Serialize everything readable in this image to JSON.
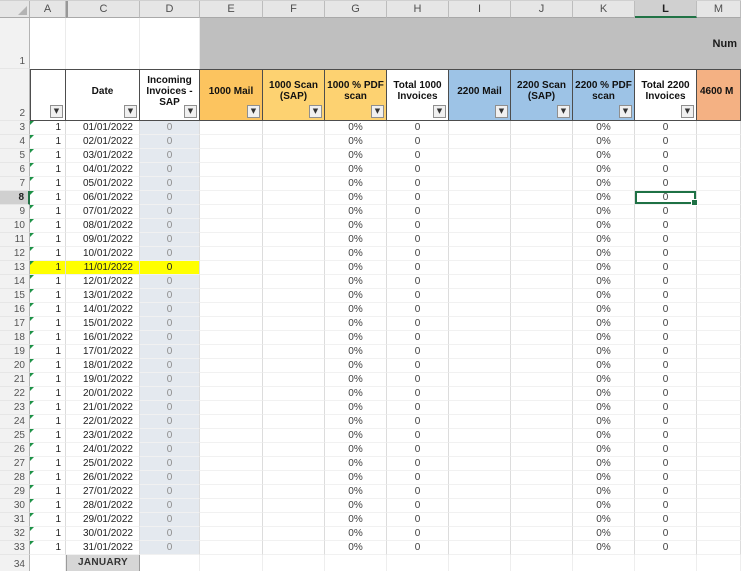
{
  "sheet": {
    "column_letters": [
      "A",
      "C",
      "D",
      "E",
      "F",
      "G",
      "H",
      "I",
      "J",
      "K",
      "L",
      "M"
    ],
    "hidden_column_after_A": true,
    "row1_n": "1",
    "header_row_n": "2",
    "row1_merged_label": "Num",
    "selection": {
      "cell": "L8",
      "column": "L",
      "row_n": 8
    },
    "highlight_color": "#ffff00",
    "selection_color": "#1e7145",
    "headers": [
      {
        "col": "A",
        "label": "",
        "bg": "#ffffff",
        "filter": true
      },
      {
        "col": "C",
        "label": "Date",
        "bg": "#ffffff",
        "filter": true
      },
      {
        "col": "D",
        "label": "Incoming Invoices - SAP",
        "bg": "#ffffff",
        "filter": true
      },
      {
        "col": "E",
        "label": "1000 Mail",
        "bg": "#fcc45f",
        "filter": true
      },
      {
        "col": "F",
        "label": "1000 Scan (SAP)",
        "bg": "#fdd271",
        "filter": true
      },
      {
        "col": "G",
        "label": "1000 % PDF scan",
        "bg": "#fdd271",
        "filter": true
      },
      {
        "col": "H",
        "label": "Total 1000 Invoices",
        "bg": "#ffffff",
        "filter": true
      },
      {
        "col": "I",
        "label": "2200 Mail",
        "bg": "#9dc3e6",
        "filter": true
      },
      {
        "col": "J",
        "label": "2200 Scan (SAP)",
        "bg": "#9dc3e6",
        "filter": true
      },
      {
        "col": "K",
        "label": "2200 % PDF scan",
        "bg": "#9dc3e6",
        "filter": true
      },
      {
        "col": "L",
        "label": "Total 2200 Invoices",
        "bg": "#ffffff",
        "filter": true
      },
      {
        "col": "M",
        "label": "4600 M",
        "bg": "#f4b183",
        "filter": false
      }
    ],
    "rows": [
      {
        "n": 3,
        "A": "1",
        "C": "01/01/2022",
        "D": "0",
        "G": "0%",
        "H": "0",
        "K": "0%",
        "L": "0"
      },
      {
        "n": 4,
        "A": "1",
        "C": "02/01/2022",
        "D": "0",
        "G": "0%",
        "H": "0",
        "K": "0%",
        "L": "0"
      },
      {
        "n": 5,
        "A": "1",
        "C": "03/01/2022",
        "D": "0",
        "G": "0%",
        "H": "0",
        "K": "0%",
        "L": "0"
      },
      {
        "n": 6,
        "A": "1",
        "C": "04/01/2022",
        "D": "0",
        "G": "0%",
        "H": "0",
        "K": "0%",
        "L": "0"
      },
      {
        "n": 7,
        "A": "1",
        "C": "05/01/2022",
        "D": "0",
        "G": "0%",
        "H": "0",
        "K": "0%",
        "L": "0"
      },
      {
        "n": 8,
        "A": "1",
        "C": "06/01/2022",
        "D": "0",
        "G": "0%",
        "H": "0",
        "K": "0%",
        "L": "0"
      },
      {
        "n": 9,
        "A": "1",
        "C": "07/01/2022",
        "D": "0",
        "G": "0%",
        "H": "0",
        "K": "0%",
        "L": "0"
      },
      {
        "n": 10,
        "A": "1",
        "C": "08/01/2022",
        "D": "0",
        "G": "0%",
        "H": "0",
        "K": "0%",
        "L": "0"
      },
      {
        "n": 11,
        "A": "1",
        "C": "09/01/2022",
        "D": "0",
        "G": "0%",
        "H": "0",
        "K": "0%",
        "L": "0"
      },
      {
        "n": 12,
        "A": "1",
        "C": "10/01/2022",
        "D": "0",
        "G": "0%",
        "H": "0",
        "K": "0%",
        "L": "0"
      },
      {
        "n": 13,
        "A": "1",
        "C": "11/01/2022",
        "D": "0",
        "G": "0%",
        "H": "0",
        "K": "0%",
        "L": "0",
        "highlighted": true
      },
      {
        "n": 14,
        "A": "1",
        "C": "12/01/2022",
        "D": "0",
        "G": "0%",
        "H": "0",
        "K": "0%",
        "L": "0"
      },
      {
        "n": 15,
        "A": "1",
        "C": "13/01/2022",
        "D": "0",
        "G": "0%",
        "H": "0",
        "K": "0%",
        "L": "0"
      },
      {
        "n": 16,
        "A": "1",
        "C": "14/01/2022",
        "D": "0",
        "G": "0%",
        "H": "0",
        "K": "0%",
        "L": "0"
      },
      {
        "n": 17,
        "A": "1",
        "C": "15/01/2022",
        "D": "0",
        "G": "0%",
        "H": "0",
        "K": "0%",
        "L": "0"
      },
      {
        "n": 18,
        "A": "1",
        "C": "16/01/2022",
        "D": "0",
        "G": "0%",
        "H": "0",
        "K": "0%",
        "L": "0"
      },
      {
        "n": 19,
        "A": "1",
        "C": "17/01/2022",
        "D": "0",
        "G": "0%",
        "H": "0",
        "K": "0%",
        "L": "0"
      },
      {
        "n": 20,
        "A": "1",
        "C": "18/01/2022",
        "D": "0",
        "G": "0%",
        "H": "0",
        "K": "0%",
        "L": "0"
      },
      {
        "n": 21,
        "A": "1",
        "C": "19/01/2022",
        "D": "0",
        "G": "0%",
        "H": "0",
        "K": "0%",
        "L": "0"
      },
      {
        "n": 22,
        "A": "1",
        "C": "20/01/2022",
        "D": "0",
        "G": "0%",
        "H": "0",
        "K": "0%",
        "L": "0"
      },
      {
        "n": 23,
        "A": "1",
        "C": "21/01/2022",
        "D": "0",
        "G": "0%",
        "H": "0",
        "K": "0%",
        "L": "0"
      },
      {
        "n": 24,
        "A": "1",
        "C": "22/01/2022",
        "D": "0",
        "G": "0%",
        "H": "0",
        "K": "0%",
        "L": "0"
      },
      {
        "n": 25,
        "A": "1",
        "C": "23/01/2022",
        "D": "0",
        "G": "0%",
        "H": "0",
        "K": "0%",
        "L": "0"
      },
      {
        "n": 26,
        "A": "1",
        "C": "24/01/2022",
        "D": "0",
        "G": "0%",
        "H": "0",
        "K": "0%",
        "L": "0"
      },
      {
        "n": 27,
        "A": "1",
        "C": "25/01/2022",
        "D": "0",
        "G": "0%",
        "H": "0",
        "K": "0%",
        "L": "0"
      },
      {
        "n": 28,
        "A": "1",
        "C": "26/01/2022",
        "D": "0",
        "G": "0%",
        "H": "0",
        "K": "0%",
        "L": "0"
      },
      {
        "n": 29,
        "A": "1",
        "C": "27/01/2022",
        "D": "0",
        "G": "0%",
        "H": "0",
        "K": "0%",
        "L": "0"
      },
      {
        "n": 30,
        "A": "1",
        "C": "28/01/2022",
        "D": "0",
        "G": "0%",
        "H": "0",
        "K": "0%",
        "L": "0"
      },
      {
        "n": 31,
        "A": "1",
        "C": "29/01/2022",
        "D": "0",
        "G": "0%",
        "H": "0",
        "K": "0%",
        "L": "0"
      },
      {
        "n": 32,
        "A": "1",
        "C": "30/01/2022",
        "D": "0",
        "G": "0%",
        "H": "0",
        "K": "0%",
        "L": "0"
      },
      {
        "n": 33,
        "A": "1",
        "C": "31/01/2022",
        "D": "0",
        "G": "0%",
        "H": "0",
        "K": "0%",
        "L": "0"
      }
    ],
    "footer": {
      "row_n": "34",
      "label": "JANUARY",
      "label_col": "C"
    }
  }
}
